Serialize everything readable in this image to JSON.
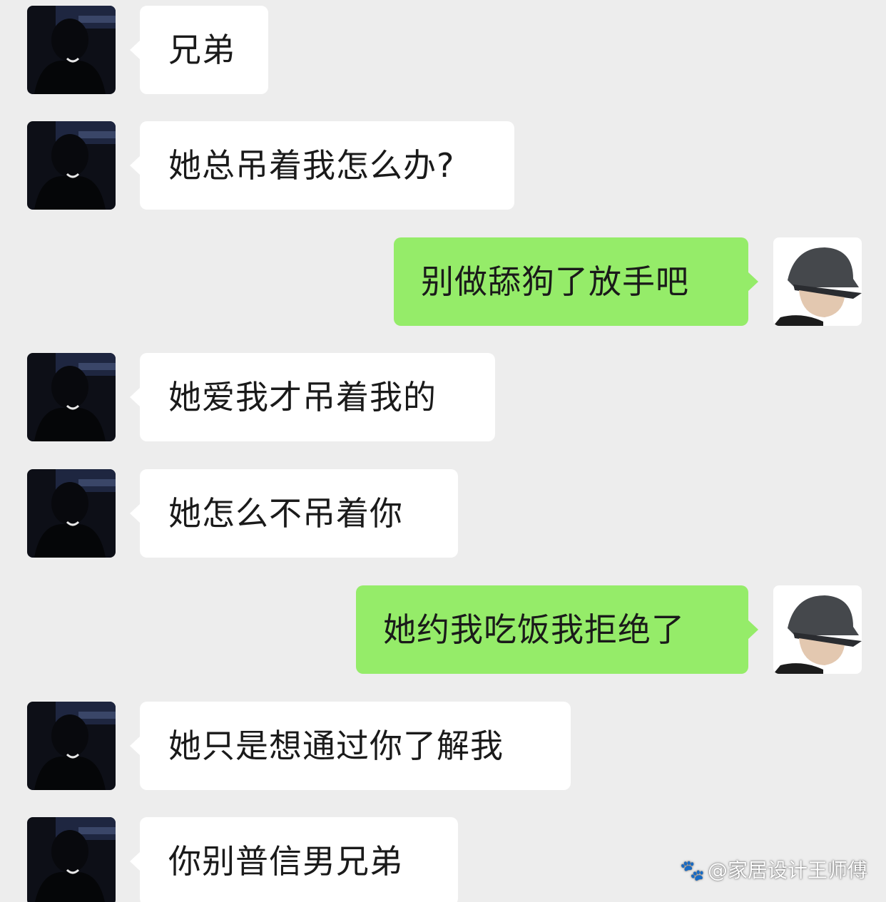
{
  "messages": [
    {
      "side": "in",
      "text": "兄弟"
    },
    {
      "side": "in",
      "text": "她总吊着我怎么办?"
    },
    {
      "side": "out",
      "text": "别做舔狗了放手吧"
    },
    {
      "side": "in",
      "text": "她爱我才吊着我的"
    },
    {
      "side": "in",
      "text": "她怎么不吊着你"
    },
    {
      "side": "out",
      "text": "她约我吃饭我拒绝了"
    },
    {
      "side": "in",
      "text": "她只是想通过你了解我"
    },
    {
      "side": "in",
      "text": "你别普信男兄弟"
    }
  ],
  "watermark": {
    "icon": "paw-icon",
    "text": "@家居设计王师傅"
  },
  "colors": {
    "background": "#ededed",
    "incoming_bubble": "#ffffff",
    "outgoing_bubble": "#95ec69"
  }
}
